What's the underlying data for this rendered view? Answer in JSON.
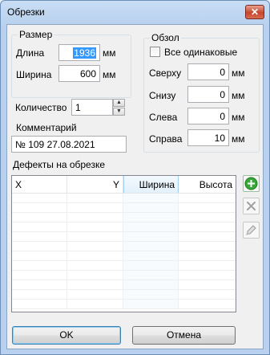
{
  "window": {
    "title": "Обрезки",
    "close_glyph": "✕"
  },
  "size_group": {
    "legend": "Размер",
    "length_label": "Длина",
    "length_value": "1936",
    "length_unit": "мм",
    "width_label": "Ширина",
    "width_value": "600",
    "width_unit": "мм"
  },
  "trim_group": {
    "legend": "Обзол",
    "all_equal_label": "Все одинаковые",
    "all_equal_checked": false,
    "top_label": "Сверху",
    "top_value": "0",
    "bottom_label": "Снизу",
    "bottom_value": "0",
    "left_label": "Слева",
    "left_value": "0",
    "right_label": "Справа",
    "right_value": "10",
    "unit": "мм"
  },
  "quantity": {
    "label": "Количество",
    "value": "1"
  },
  "comment": {
    "label": "Комментарий",
    "value": "№ 109 27.08.2021"
  },
  "defects": {
    "label": "Дефекты на обрезке",
    "columns": [
      "X",
      "Y",
      "Ширина",
      "Высота"
    ],
    "sorted_column": "Ширина",
    "rows": []
  },
  "side_buttons": {
    "add_icon": "add-icon",
    "delete_icon": "delete-icon",
    "edit_icon": "edit-icon"
  },
  "footer": {
    "ok_label": "OK",
    "cancel_label": "Отмена"
  },
  "colors": {
    "title_bar": "#b9d1ee",
    "add_green": "#3aa63a",
    "selection": "#3399ff"
  }
}
